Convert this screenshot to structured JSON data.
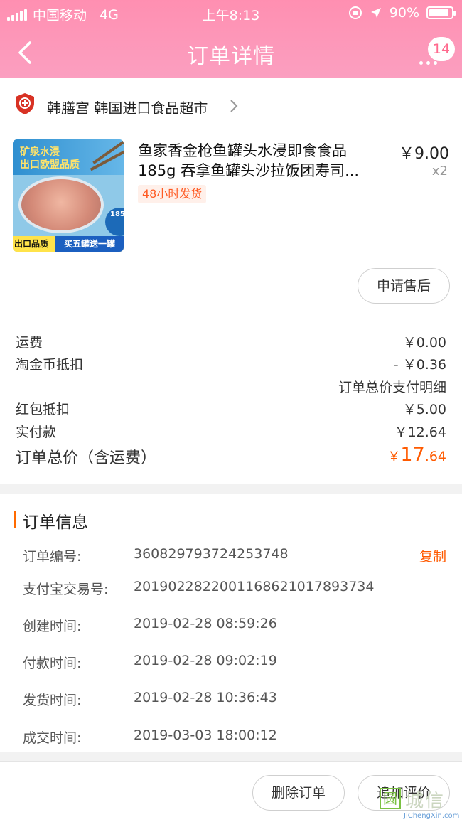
{
  "status_bar": {
    "carrier": "中国移动",
    "network": "4G",
    "time": "上午8:13",
    "battery": "90%",
    "battery_level": 0.9
  },
  "nav": {
    "title": "订单详情",
    "badge_count": "14",
    "back_icon": "chevron-left-icon",
    "more_icon": "more-dots-icon"
  },
  "shop": {
    "name": "韩膳宫 韩国进口食品超市",
    "logo_icon": "shield-company-icon"
  },
  "product": {
    "image_texts": {
      "line1": "矿泉水浸",
      "line2": "出口欧盟品质",
      "can_weight": "185g",
      "bottom_left": "出口品质",
      "bottom_right": "买五罐送一罐"
    },
    "title_line1": "鱼家香金枪鱼罐头水浸即食食品",
    "title_line2": "185g 吞拿鱼罐头沙拉饭团寿司...",
    "price": "￥9.00",
    "qty": "x2",
    "tag": "48小时发货",
    "after_sale_button": "申请售后"
  },
  "summary": {
    "rows": [
      {
        "label": "运费",
        "value": "￥0.00"
      },
      {
        "label": "淘金币抵扣",
        "value": "- ￥0.36"
      },
      {
        "label": "",
        "value": "订单总价支付明细"
      },
      {
        "label": "红包抵扣",
        "value": "￥5.00"
      },
      {
        "label": "实付款",
        "value": "￥12.64"
      }
    ],
    "total_label": "订单总价（含运费）",
    "total_currency": "￥",
    "total_int": "17",
    "total_dec": ".64"
  },
  "order_info": {
    "section_title": "订单信息",
    "copy_button": "复制",
    "fields": [
      {
        "key": "订单编号:",
        "value": "360829793724253748"
      },
      {
        "key": "支付宝交易号:",
        "value": "2019022822001168621017893734"
      },
      {
        "key": "创建时间:",
        "value": "2019-02-28 08:59:26"
      },
      {
        "key": "付款时间:",
        "value": "2019-02-28 09:02:19"
      },
      {
        "key": "发货时间:",
        "value": "2019-02-28 10:36:43"
      },
      {
        "key": "成交时间:",
        "value": "2019-03-03 18:00:12"
      }
    ]
  },
  "actions": {
    "delete_order": "删除订单",
    "add_review": "追加评价"
  },
  "watermark": {
    "mark": "圆",
    "text": "城信",
    "url": "JiChengXin.com"
  },
  "colors": {
    "header_pink": "#fb9fc0",
    "accent_orange": "#ff5a00"
  }
}
